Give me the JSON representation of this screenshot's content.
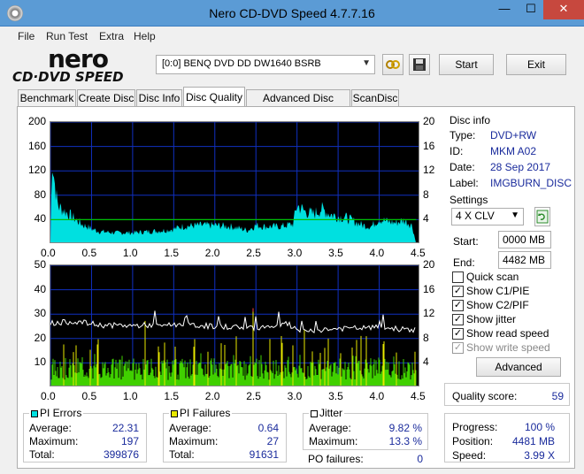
{
  "window": {
    "title": "Nero CD-DVD Speed 4.7.7.16",
    "min": "—",
    "max": "☐",
    "close": "✕"
  },
  "menu": [
    "File",
    "Run Test",
    "Extra",
    "Help"
  ],
  "logo": {
    "line1": "nero",
    "line2": "CD·DVD SPEED"
  },
  "toolbar": {
    "drive": "[0:0]  BENQ DVD DD DW1640 BSRB",
    "start": "Start",
    "exit": "Exit"
  },
  "tabs": [
    "Benchmark",
    "Create Disc",
    "Disc Info",
    "Disc Quality",
    "Advanced Disc Quality",
    "ScanDisc"
  ],
  "active_tab": "Disc Quality",
  "disc_info": {
    "title": "Disc info",
    "rows": [
      {
        "label": "Type:",
        "value": "DVD+RW"
      },
      {
        "label": "ID:",
        "value": "MKM A02"
      },
      {
        "label": "Date:",
        "value": "28 Sep 2017"
      },
      {
        "label": "Label:",
        "value": "IMGBURN_DISC"
      }
    ]
  },
  "settings": {
    "title": "Settings",
    "speed": "4 X CLV",
    "start_label": "Start:",
    "start_value": "0000 MB",
    "end_label": "End:",
    "end_value": "4482 MB",
    "checks": [
      {
        "label": "Quick scan",
        "checked": false,
        "disabled": false
      },
      {
        "label": "Show C1/PIE",
        "checked": true,
        "disabled": false
      },
      {
        "label": "Show C2/PIF",
        "checked": true,
        "disabled": false
      },
      {
        "label": "Show jitter",
        "checked": true,
        "disabled": false
      },
      {
        "label": "Show read speed",
        "checked": true,
        "disabled": false
      },
      {
        "label": "Show write speed",
        "checked": true,
        "disabled": true
      }
    ],
    "advanced": "Advanced"
  },
  "quality": {
    "label": "Quality score:",
    "value": "59"
  },
  "progress": {
    "rows": [
      {
        "label": "Progress:",
        "value": "100 %"
      },
      {
        "label": "Position:",
        "value": "4481 MB"
      },
      {
        "label": "Speed:",
        "value": "3.99 X"
      }
    ]
  },
  "pi_errors": {
    "title": "PI Errors",
    "color": "#00e0e0",
    "rows": [
      {
        "label": "Average:",
        "value": "22.31"
      },
      {
        "label": "Maximum:",
        "value": "197"
      },
      {
        "label": "Total:",
        "value": "399876"
      }
    ]
  },
  "pi_failures": {
    "title": "PI Failures",
    "color": "#e8e800",
    "rows": [
      {
        "label": "Average:",
        "value": "0.64"
      },
      {
        "label": "Maximum:",
        "value": "27"
      },
      {
        "label": "Total:",
        "value": "91631"
      }
    ]
  },
  "jitter": {
    "title": "Jitter",
    "color": "#ffffff",
    "rows": [
      {
        "label": "Average:",
        "value": "9.82 %"
      },
      {
        "label": "Maximum:",
        "value": "13.3 %"
      }
    ],
    "po_label": "PO failures:",
    "po_value": "0"
  },
  "chart_data": [
    {
      "type": "area",
      "name": "pi-errors-chart",
      "xlim": [
        0,
        4.5
      ],
      "x_ticks": [
        "0.0",
        "0.5",
        "1.0",
        "1.5",
        "2.0",
        "2.5",
        "3.0",
        "3.5",
        "4.0",
        "4.5"
      ],
      "y_left_ticks": [
        "200",
        "160",
        "120",
        "80",
        "40"
      ],
      "y_right_ticks": [
        "20",
        "16",
        "12",
        "8",
        "4"
      ],
      "ylim_left": [
        0,
        200
      ],
      "ylim_right": [
        0,
        20
      ],
      "colors": {
        "pi": "#00e0e0",
        "speed": "#00c000",
        "grid": "#1030c0"
      },
      "pi_series": {
        "x": [
          0.0,
          0.02,
          0.05,
          0.08,
          0.1,
          0.15,
          0.2,
          0.25,
          0.3,
          0.35,
          0.4,
          0.45,
          0.5,
          0.6,
          0.8,
          1.0,
          1.2,
          1.4,
          1.5,
          1.6,
          1.8,
          2.0,
          2.2,
          2.4,
          2.5,
          2.6,
          2.8,
          2.95,
          3.0,
          3.1,
          3.2,
          3.3,
          3.4,
          3.5,
          3.6,
          3.7,
          3.8,
          3.9,
          4.0,
          4.1,
          4.2,
          4.3,
          4.4,
          4.45
        ],
        "y": [
          0,
          140,
          100,
          70,
          60,
          55,
          50,
          45,
          40,
          35,
          30,
          28,
          24,
          20,
          18,
          18,
          20,
          22,
          24,
          28,
          30,
          30,
          28,
          22,
          30,
          28,
          28,
          32,
          62,
          52,
          48,
          56,
          48,
          44,
          42,
          36,
          30,
          28,
          40,
          36,
          34,
          38,
          30,
          0
        ]
      },
      "speed_series": {
        "x": [
          0.0,
          4.45
        ],
        "y": [
          4.0,
          4.0
        ]
      }
    },
    {
      "type": "bar",
      "name": "pi-failures-chart",
      "xlim": [
        0,
        4.5
      ],
      "x_ticks": [
        "0.0",
        "0.5",
        "1.0",
        "1.5",
        "2.0",
        "2.5",
        "3.0",
        "3.5",
        "4.0",
        "4.5"
      ],
      "y_left_ticks": [
        "50",
        "40",
        "30",
        "20",
        "10"
      ],
      "y_right_ticks": [
        "20",
        "16",
        "12",
        "8",
        "4"
      ],
      "ylim_left": [
        0,
        50
      ],
      "ylim_right": [
        0,
        20
      ],
      "colors": {
        "pif": "#e8e800",
        "pif_low": "#40d000",
        "jitter": "#ffffff",
        "spike": "#ff4040",
        "grid": "#1030c0"
      },
      "jitter_series": {
        "x": [
          0.0,
          0.3,
          0.6,
          1.0,
          1.5,
          2.0,
          2.5,
          2.9,
          3.0,
          3.5,
          4.0,
          4.45
        ],
        "y": [
          10.5,
          10.8,
          10.2,
          10.1,
          10.3,
          10.0,
          9.8,
          10.4,
          9.2,
          9.6,
          9.8,
          9.4
        ]
      }
    }
  ]
}
